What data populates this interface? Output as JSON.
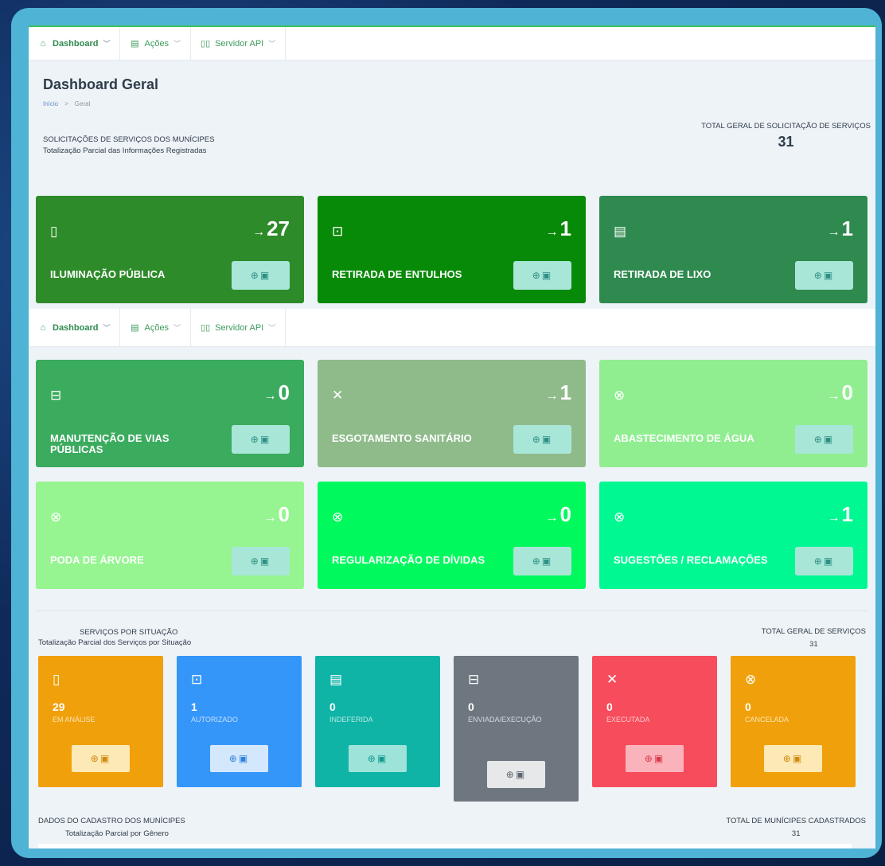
{
  "nav": {
    "items": [
      {
        "label": "Dashboard",
        "icon": "home-icon"
      },
      {
        "label": "Ações",
        "icon": "document-icon"
      },
      {
        "label": "Servidor API",
        "icon": "book-icon"
      }
    ]
  },
  "page": {
    "title": "Dashboard Geral",
    "breadcrumb": [
      "Início",
      ">",
      "Geral"
    ]
  },
  "services_section": {
    "heading": "SOLICITAÇÕES DE SERVIÇOS DOS MUNÍCIPES",
    "subheading": "Totalização Parcial das Informações Registradas",
    "total_label": "TOTAL GERAL DE SOLICITAÇÃO DE SERVIÇOS",
    "total_value": "31"
  },
  "service_cards": [
    {
      "label": "ILUMINAÇÃO PÚBLICA",
      "value": "27",
      "icon": "file-icon",
      "color": "#2e8b2a"
    },
    {
      "label": "RETIRADA DE ENTULHOS",
      "value": "1",
      "icon": "truck-icon",
      "color": "#078a07"
    },
    {
      "label": "RETIRADA DE LIXO",
      "value": "1",
      "icon": "document-icon",
      "color": "#2f8a4f"
    },
    {
      "label": "MANUTENÇÃO DE VIAS PÚBLICAS",
      "value": "0",
      "icon": "archive-icon",
      "color": "#3bab5e"
    },
    {
      "label": "ESGOTAMENTO SANITÁRIO",
      "value": "1",
      "icon": "close-icon",
      "color": "#8fbb8b"
    },
    {
      "label": "ABASTECIMENTO DE ÁGUA",
      "value": "0",
      "icon": "cancel-circle-icon",
      "color": "#90ee90"
    },
    {
      "label": "PODA DE ÁRVORE",
      "value": "0",
      "icon": "cancel-circle-icon",
      "color": "#96f591"
    },
    {
      "label": "REGULARIZAÇÃO DE DÍVIDAS",
      "value": "0",
      "icon": "cancel-circle-icon",
      "color": "#00fa5e"
    },
    {
      "label": "SUGESTÕES / RECLAMAÇÕES",
      "value": "1",
      "icon": "cancel-circle-icon",
      "color": "#00f893"
    }
  ],
  "card_button": {
    "icons": "🔍🖶"
  },
  "status_section": {
    "heading": "SERVIÇOS POR SITUAÇÃO",
    "subheading": "Totalização Parcial dos Serviços por Situação",
    "total_label": "TOTAL GERAL DE SERVIÇOS",
    "total_value": "31"
  },
  "status_cards": [
    {
      "label": "EM ANÁLISE",
      "value": "29",
      "icon": "file-icon",
      "color": "#f0a00a",
      "btn_bg": "#fde9b5",
      "btn_fg": "#d08a10"
    },
    {
      "label": "AUTORIZADO",
      "value": "1",
      "icon": "truck-icon",
      "color": "#3596fa",
      "btn_bg": "#d4e8fd",
      "btn_fg": "#2f80d8"
    },
    {
      "label": "INDEFERIDA",
      "value": "0",
      "icon": "document-icon",
      "color": "#0fb4a6",
      "btn_bg": "#9ee3da",
      "btn_fg": "#139a8e"
    },
    {
      "label": "ENVIADA/EXECUÇÃO",
      "value": "0",
      "icon": "archive-icon",
      "color": "#6e7780",
      "btn_bg": "#e6e8ea",
      "btn_fg": "#5d656d"
    },
    {
      "label": "EXECUTADA",
      "value": "0",
      "icon": "close-icon",
      "color": "#f64c5b",
      "btn_bg": "#fbb3bb",
      "btn_fg": "#d83b4a"
    },
    {
      "label": "CANCELADA",
      "value": "0",
      "icon": "cancel-circle-icon",
      "color": "#f0a00a",
      "btn_bg": "#fde9b5",
      "btn_fg": "#d08a10"
    }
  ],
  "citizens_section": {
    "heading": "DADOS DO CADASTRO DOS MUNÍCIPES",
    "subheading": "Totalização Parcial por Gênero",
    "total_label": "TOTAL DE MUNÍCIPES CADASTRADOS",
    "total_value": "31"
  }
}
